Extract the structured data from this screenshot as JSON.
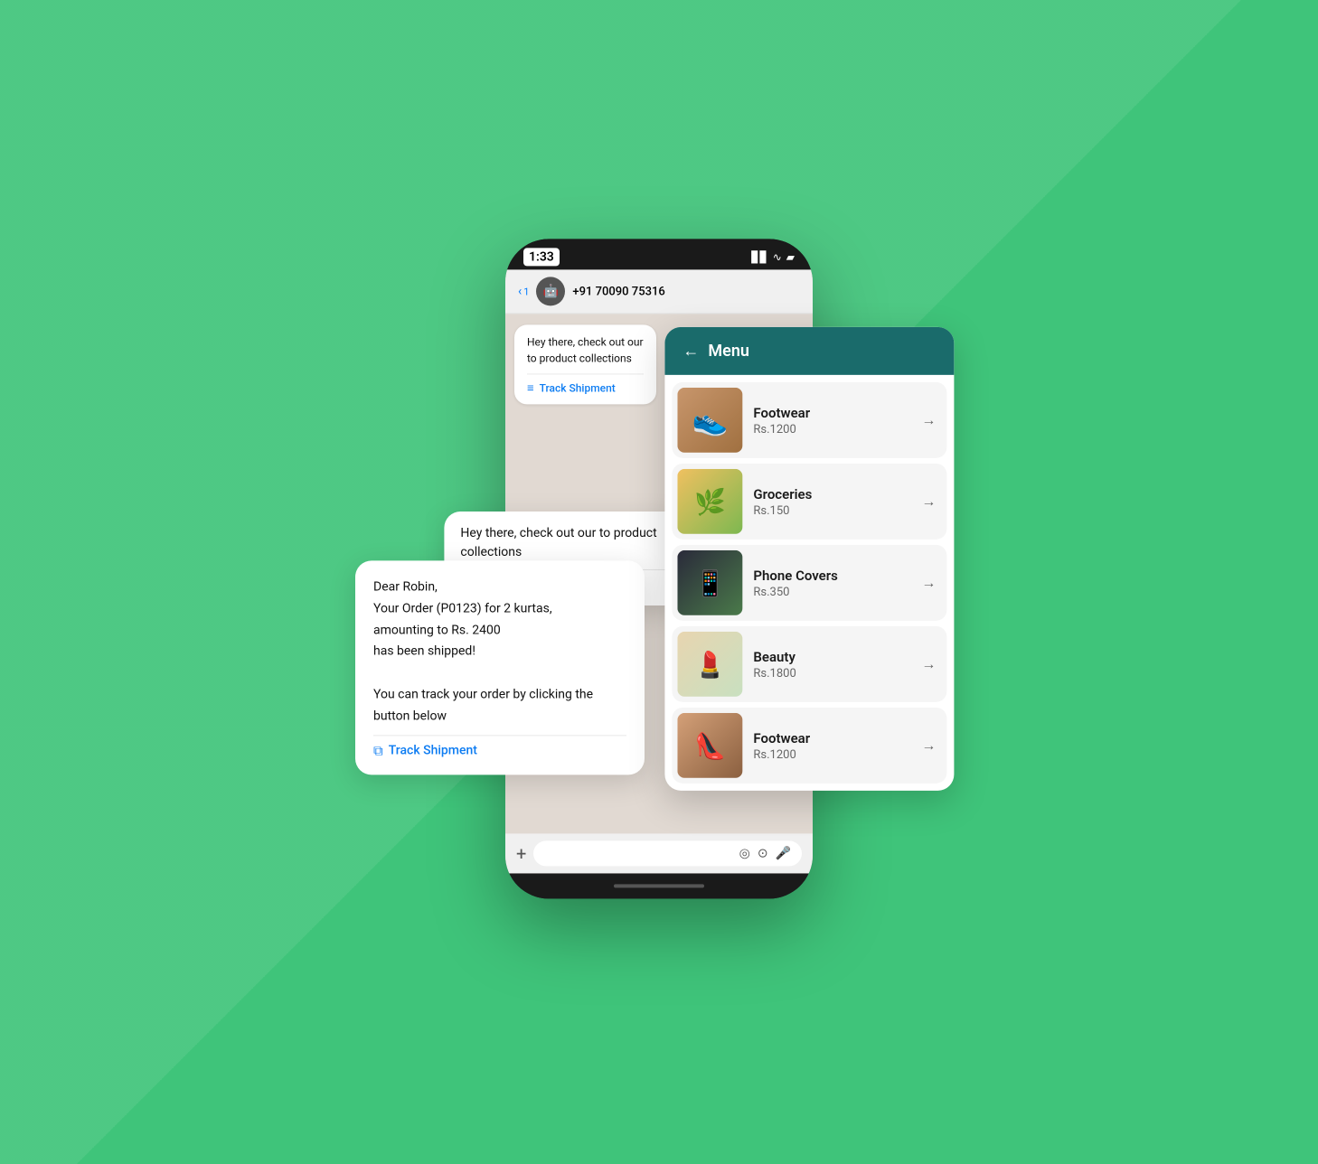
{
  "background": {
    "color": "#3fc47a"
  },
  "phone": {
    "time": "1:33",
    "status_icons": "▐▌ ⊛ 🔋",
    "contact_back": "< 1",
    "contact_avatar": "🤖",
    "contact_number": "+91 70090 75316"
  },
  "floating_bubble_top": {
    "text": "Hey there, check out our to product collections",
    "action_label": "Track Shipment",
    "action_icon": "≡"
  },
  "floating_bubble_bottom": {
    "text_line1": "Dear Robin,",
    "text_line2": "Your Order (P0123) for 2 kurtas,",
    "text_line3": "amounting to Rs. 2400",
    "text_line4": "has been shipped!",
    "text_line5": "",
    "text_line6": "You can track your order by clicking the",
    "text_line7": "button below",
    "action_label": "Track Shipment",
    "action_icon": "⧉"
  },
  "menu": {
    "header_title": "Menu",
    "items": [
      {
        "name": "Footwear",
        "price": "Rs.1200",
        "img_type": "shoes"
      },
      {
        "name": "Groceries",
        "price": "Rs.150",
        "img_type": "groceries"
      },
      {
        "name": "Phone Covers",
        "price": "Rs.350",
        "img_type": "phone"
      },
      {
        "name": "Beauty",
        "price": "Rs.1800",
        "img_type": "beauty"
      },
      {
        "name": "Footwear",
        "price": "Rs.1200",
        "img_type": "shoes2"
      }
    ]
  },
  "chat_input": {
    "plus_icon": "+",
    "emoji_icon": "◎",
    "camera_icon": "📷",
    "mic_icon": "🎤"
  },
  "labels": {
    "back_arrow": "←",
    "arrow_right": "→"
  }
}
